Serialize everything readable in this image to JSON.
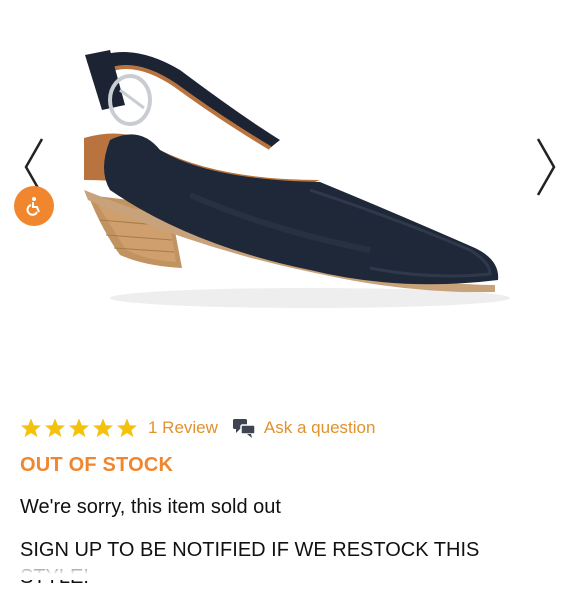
{
  "gallery": {
    "image_alt": "Navy leather pointed-toe slingback heel",
    "prev_icon": "chevron-left-icon",
    "next_icon": "chevron-right-icon",
    "accessibility_icon": "accessibility-icon",
    "accent_color": "#f0872f"
  },
  "rating": {
    "stars_value": 5,
    "stars_max": 5,
    "star_color": "#f4c20d",
    "review_label": "1 Review",
    "ask_label": "Ask a question",
    "ask_icon": "chat-bubbles-icon",
    "link_color": "#e0922e"
  },
  "status": {
    "stock_label": "OUT OF STOCK",
    "sold_message": "We're sorry, this item sold out",
    "signup_message": "SIGN UP TO BE NOTIFIED IF WE RESTOCK THIS STYLE!"
  }
}
